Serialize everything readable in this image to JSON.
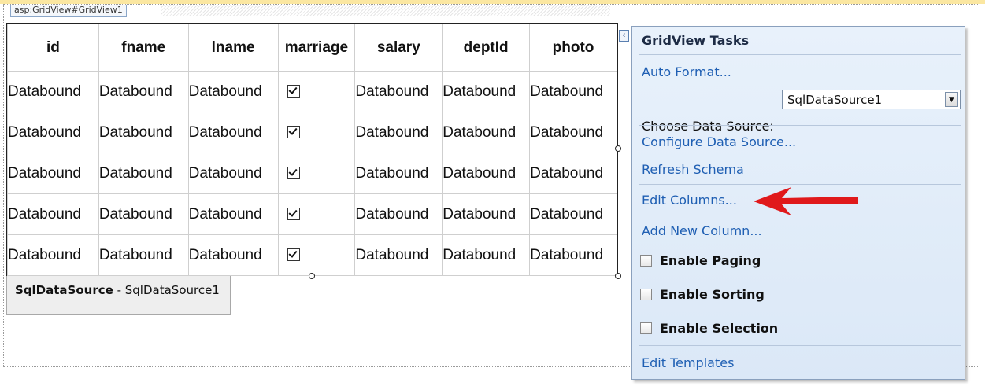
{
  "control_tag": "asp:GridView#GridView1",
  "grid": {
    "headers": [
      "id",
      "fname",
      "lname",
      "marriage",
      "salary",
      "deptId",
      "photo"
    ],
    "rows": [
      [
        "Databound",
        "Databound",
        "Databound",
        "checked",
        "Databound",
        "Databound",
        "Databound"
      ],
      [
        "Databound",
        "Databound",
        "Databound",
        "checked",
        "Databound",
        "Databound",
        "Databound"
      ],
      [
        "Databound",
        "Databound",
        "Databound",
        "checked",
        "Databound",
        "Databound",
        "Databound"
      ],
      [
        "Databound",
        "Databound",
        "Databound",
        "checked",
        "Databound",
        "Databound",
        "Databound"
      ],
      [
        "Databound",
        "Databound",
        "Databound",
        "checked",
        "Databound",
        "Databound",
        "Databound"
      ]
    ]
  },
  "sqldatasource": {
    "type": "SqlDataSource",
    "separator": " - ",
    "id": "SqlDataSource1"
  },
  "tasks": {
    "title": "GridView Tasks",
    "auto_format": "Auto Format...",
    "choose_label": "Choose Data Source:",
    "choose_value": "SqlDataSource1",
    "configure": "Configure Data Source...",
    "refresh": "Refresh Schema",
    "edit_columns": "Edit Columns...",
    "add_column": "Add New Column...",
    "enable_paging": "Enable Paging",
    "enable_sorting": "Enable Sorting",
    "enable_selection": "Enable Selection",
    "edit_templates": "Edit Templates"
  },
  "colors": {
    "link": "#1f5fb3",
    "annotation_arrow": "#e0191b",
    "panel_bg": "#e3eef9"
  },
  "icons": {
    "collapse": "chevron-left-icon",
    "dropdown": "chevron-down-icon",
    "annotation": "red-arrow-icon"
  }
}
